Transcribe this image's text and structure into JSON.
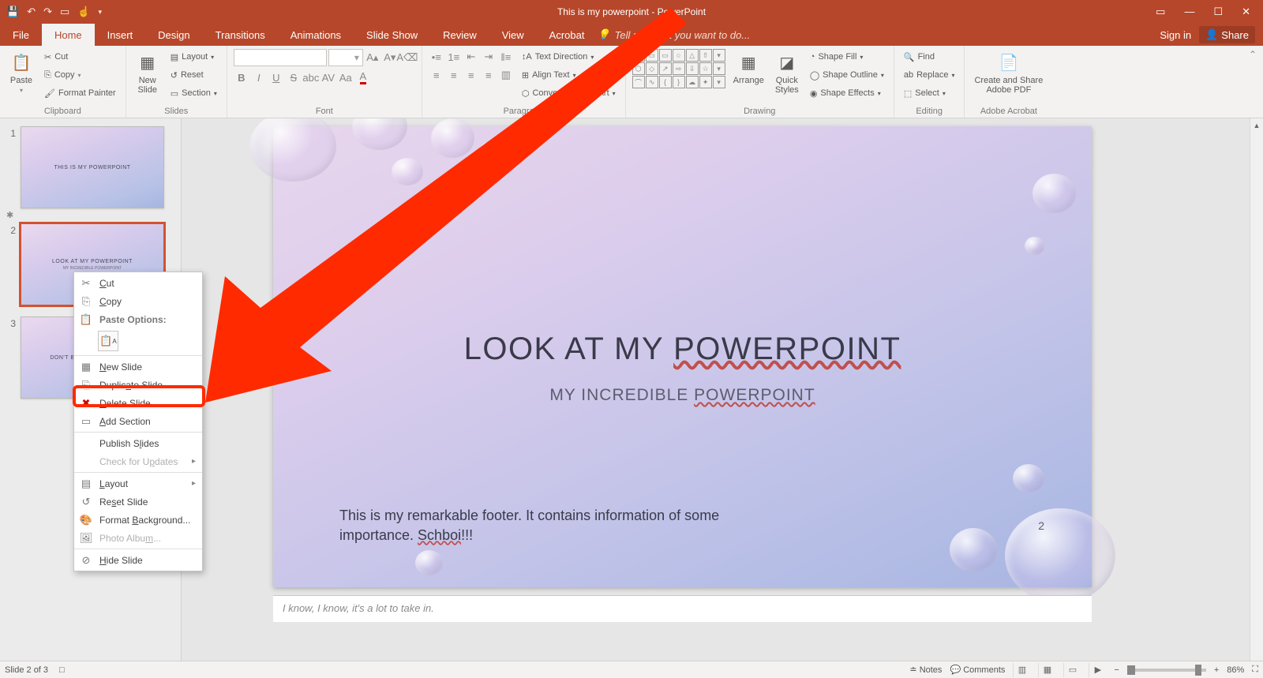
{
  "window": {
    "title": "This is my powerpoint - PowerPoint",
    "sign_in": "Sign in",
    "share": "Share"
  },
  "tabs": {
    "file": "File",
    "home": "Home",
    "insert": "Insert",
    "design": "Design",
    "transitions": "Transitions",
    "animations": "Animations",
    "slideshow": "Slide Show",
    "review": "Review",
    "view": "View",
    "acrobat": "Acrobat",
    "tell": "Tell me what you want to do..."
  },
  "ribbon": {
    "clipboard": {
      "label": "Clipboard",
      "paste": "Paste",
      "cut": "Cut",
      "copy": "Copy",
      "fp": "Format Painter"
    },
    "slides": {
      "label": "Slides",
      "new": "New\nSlide",
      "layout": "Layout",
      "reset": "Reset",
      "section": "Section"
    },
    "font": {
      "label": "Font"
    },
    "paragraph": {
      "label": "Paragraph",
      "td": "Text Direction",
      "at": "Align Text",
      "sa": "Convert to SmartArt"
    },
    "drawing": {
      "label": "Drawing",
      "arrange": "Arrange",
      "qs": "Quick\nStyles",
      "sf": "Shape Fill",
      "so": "Shape Outline",
      "se": "Shape Effects"
    },
    "editing": {
      "label": "Editing",
      "find": "Find",
      "replace": "Replace",
      "select": "Select"
    },
    "adobe": {
      "label": "Adobe Acrobat",
      "main": "Create and Share\nAdobe PDF"
    }
  },
  "thumbs": [
    {
      "n": "1",
      "title": "THIS IS MY POWERPOINT",
      "sub": ""
    },
    {
      "n": "2",
      "title": "LOOK AT MY POWERPOINT",
      "sub": "MY INCREDIBLE POWERPOINT"
    },
    {
      "n": "3",
      "title": "DON'T BE TOO INTIMIDATED",
      "sub": ""
    }
  ],
  "ctx": {
    "cut": "Cut",
    "copy": "Copy",
    "paste_h": "Paste Options:",
    "new": "New Slide",
    "dup": "Duplicate Slide",
    "del": "Delete Slide",
    "add": "Add Section",
    "pub": "Publish Slides",
    "upd": "Check for Updates",
    "layout": "Layout",
    "reset": "Reset Slide",
    "fmt": "Format Background...",
    "album": "Photo Album...",
    "hide": "Hide Slide"
  },
  "slide": {
    "title_a": "LOOK AT MY ",
    "title_b": "POWERPOINT",
    "sub_a": "MY INCREDIBLE ",
    "sub_b": "POWERPOINT",
    "footer_a": "This is my remarkable footer. It contains information of some importance. ",
    "footer_b": "Schboi",
    "footer_c": "!!!",
    "page": "2"
  },
  "notes": "I know, I know, it's a lot to take in.",
  "status": {
    "slide": "Slide 2 of 3",
    "notes": "Notes",
    "comments": "Comments",
    "zoom": "86%"
  }
}
